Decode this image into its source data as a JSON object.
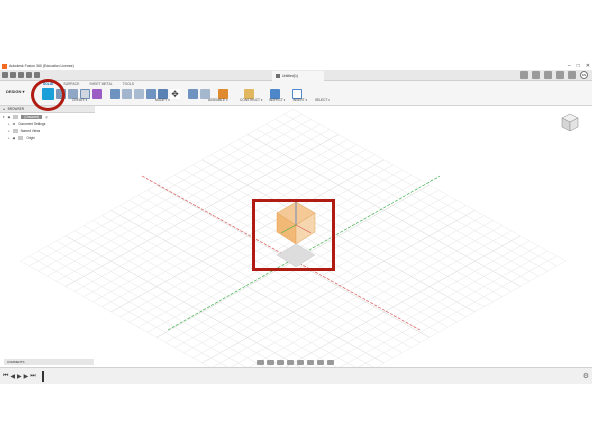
{
  "window": {
    "title": "Autodesk Fusion 360 (Education License)",
    "controls": [
      "–",
      "□",
      "✕"
    ]
  },
  "tabbar": {
    "document_tab": "Untitled(1)",
    "user_initials": "KS"
  },
  "toolbar": {
    "workspace": "DESIGN ▾",
    "tabs": [
      "SOLID",
      "SURFACE",
      "SHEET METAL",
      "TOOLS"
    ],
    "active_tab": "SOLID",
    "groups": [
      "CREATE ▾",
      "MODIFY ▾",
      "ASSEMBLE ▾",
      "CONSTRUCT ▾",
      "INSPECT ▾",
      "INSERT ▾",
      "SELECT ▾"
    ]
  },
  "browser": {
    "title": "BROWSER",
    "items": [
      {
        "label": "(Unsaved)"
      },
      {
        "label": "Document Settings"
      },
      {
        "label": "Named Views"
      },
      {
        "label": "Origin"
      }
    ]
  },
  "comments": {
    "title": "COMMENTS"
  },
  "colors": {
    "highlight": "#b01c12",
    "x_axis": "#d9534f",
    "y_axis": "#3cb04a",
    "origin_plane": "#f4a340",
    "sketch_icon": "#1a9fd9"
  },
  "icons": {
    "app": "fusion-logo-icon",
    "sketch": "create-sketch-icon",
    "viewcube": "viewcube-icon",
    "settings": "gear-icon"
  }
}
